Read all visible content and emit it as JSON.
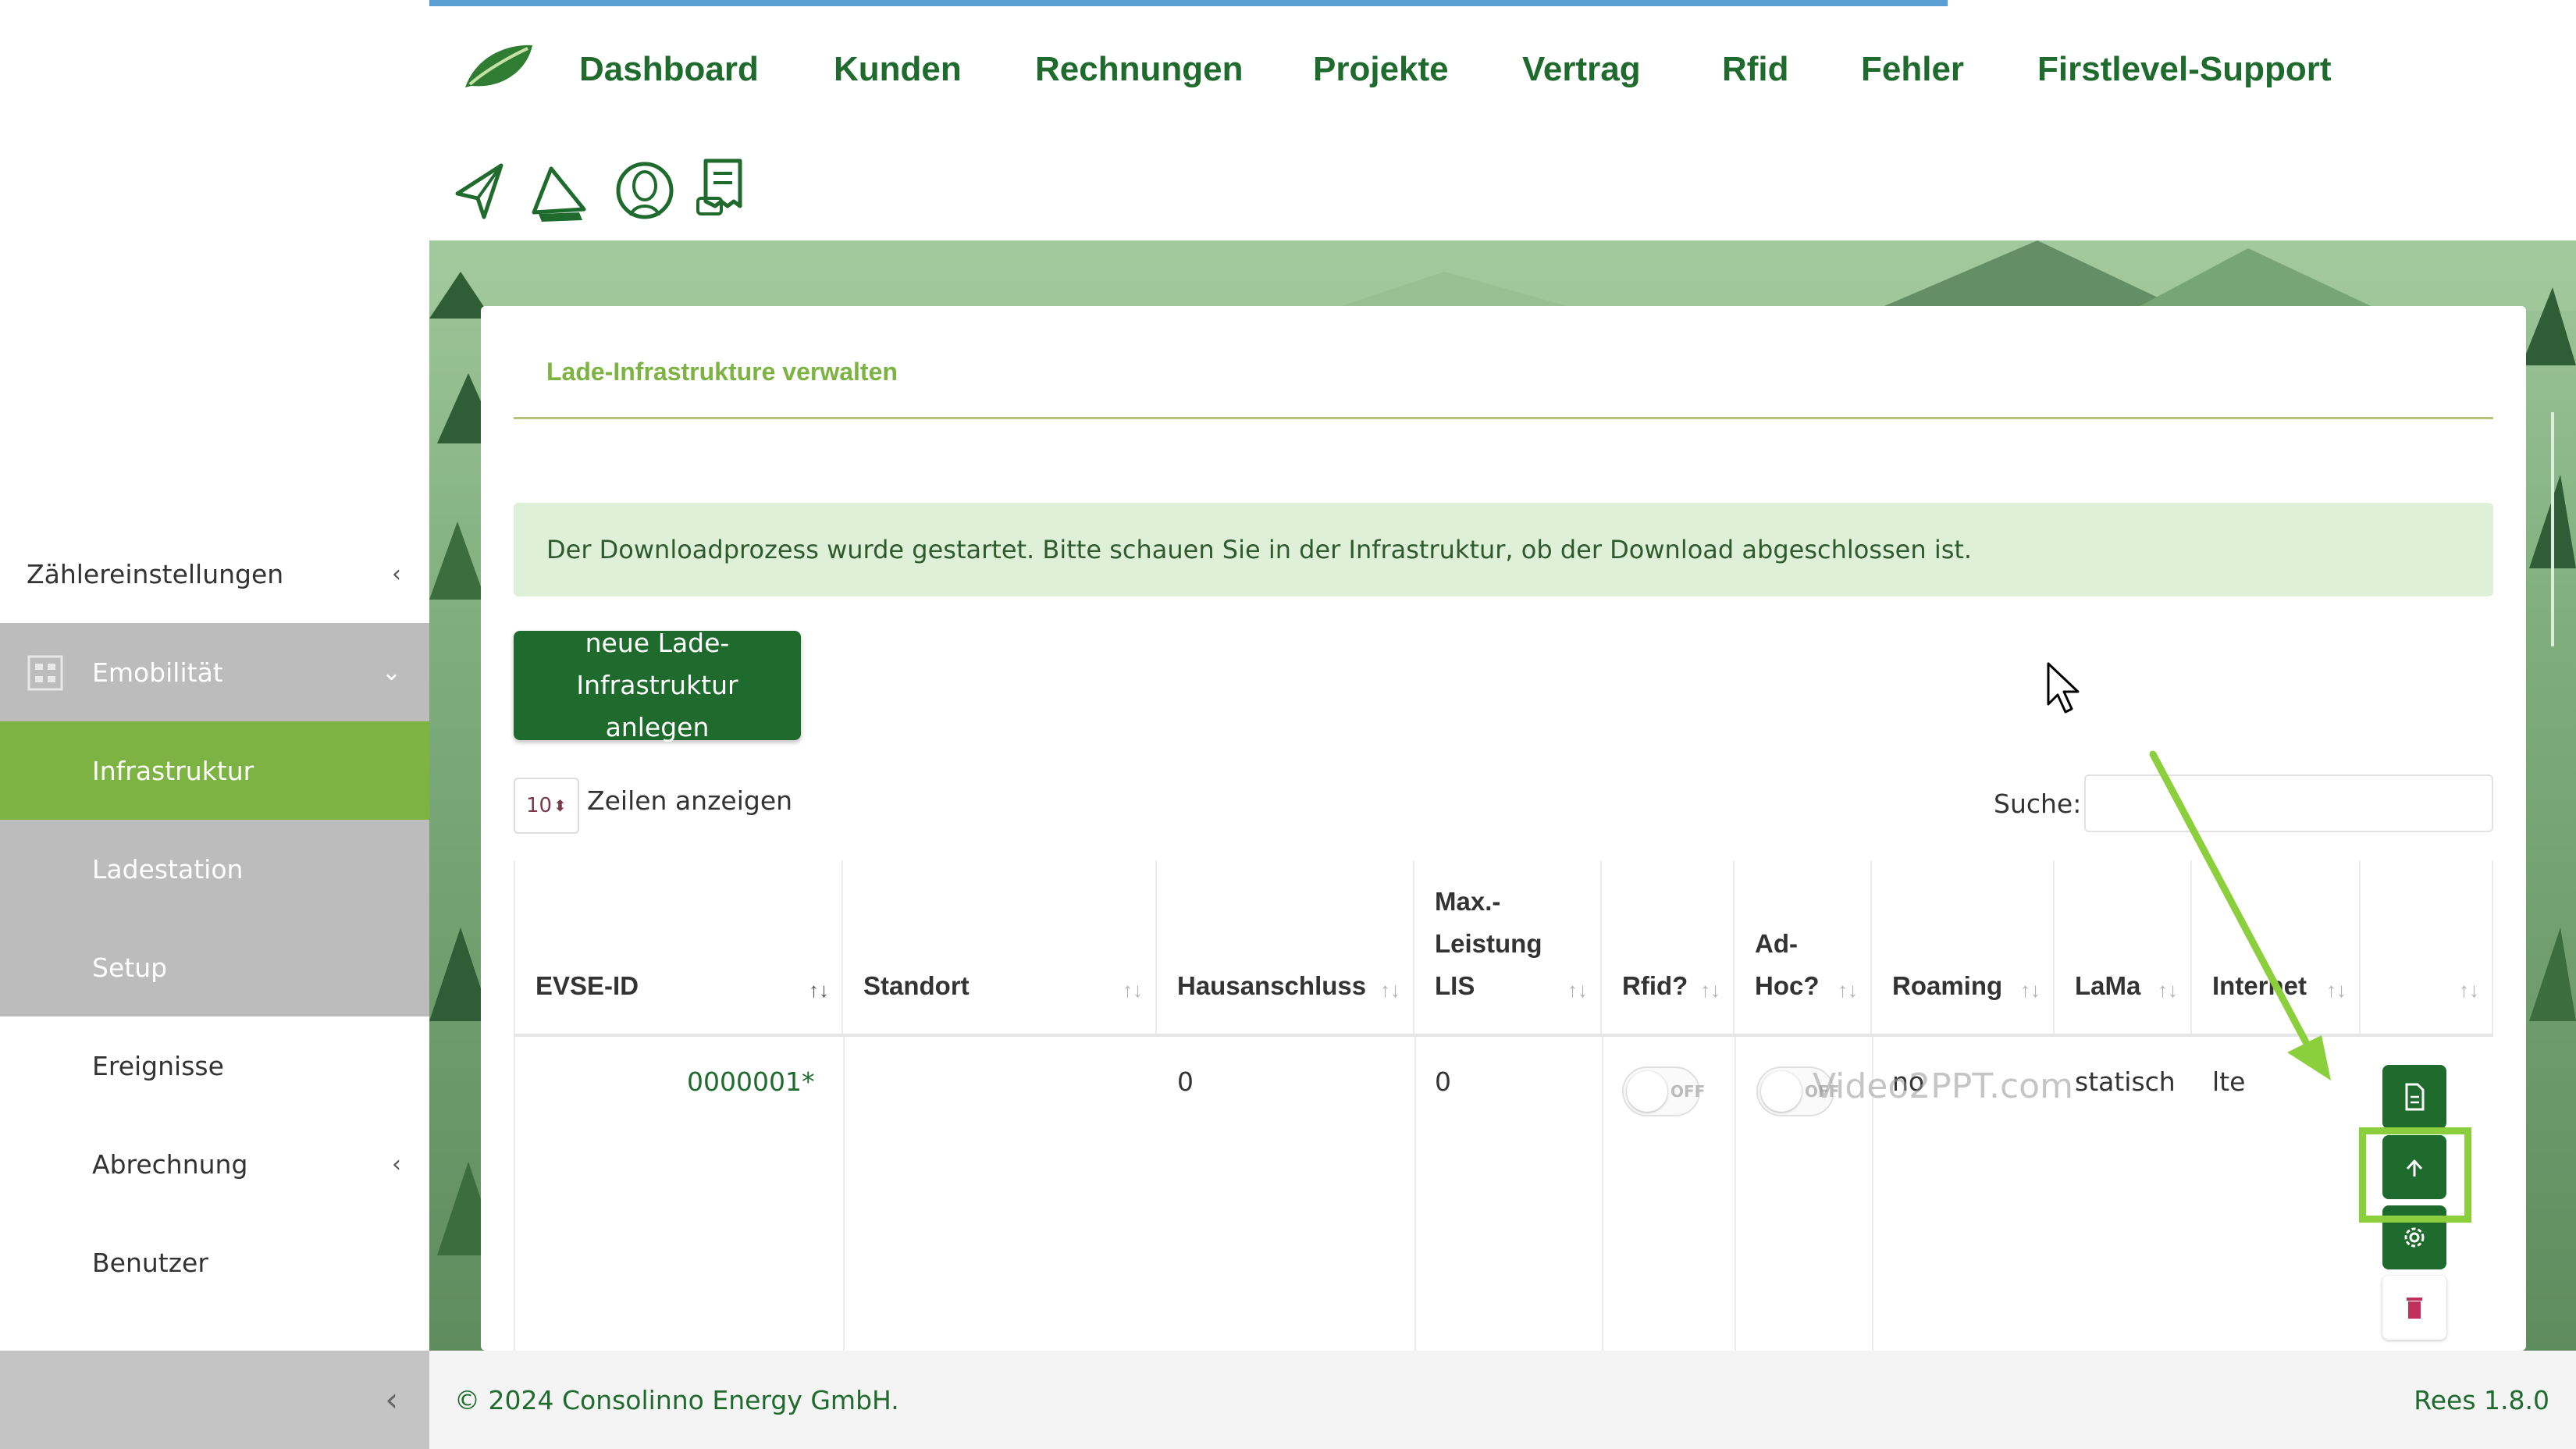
{
  "app": {
    "nav": [
      "Dashboard",
      "Kunden",
      "Rechnungen",
      "Projekte",
      "Vertrag",
      "Rfid",
      "Fehler",
      "Firstlevel-Support"
    ],
    "tool_icons": [
      "send-icon",
      "megaphone-icon",
      "support-agent-icon",
      "receipt-icon"
    ],
    "accent_color": "#1f6b2e",
    "highlight_color": "#7cb342"
  },
  "sidebar": {
    "items": [
      {
        "label": "Zählereinstellungen",
        "chevron": "‹"
      },
      {
        "label": "Emobilität",
        "chevron": "⌄",
        "icon": "grid-icon"
      },
      {
        "label": "Infrastruktur"
      },
      {
        "label": "Ladestation"
      },
      {
        "label": "Setup"
      },
      {
        "label": "Ereignisse"
      },
      {
        "label": "Abrechnung",
        "chevron": "‹"
      },
      {
        "label": "Benutzer"
      }
    ],
    "collapse_chevron": "‹"
  },
  "card": {
    "title": "Lade-Infrastrukture verwalten",
    "alert": "Der Downloadprozess wurde gestartet. Bitte schauen Sie in der Infrastruktur, ob der Download abgeschlossen ist.",
    "new_button": "neue Lade-Infrastruktur anlegen",
    "page_length": "10",
    "page_length_label": "Zeilen anzeigen",
    "search_label": "Suche:",
    "search_value": ""
  },
  "table": {
    "columns": [
      {
        "label": "EVSE-ID"
      },
      {
        "label": "Standort"
      },
      {
        "label": "Hausanschluss"
      },
      {
        "label": "Max.-Leistung LIS"
      },
      {
        "label": "Rfid?"
      },
      {
        "label": "Ad-Hoc?"
      },
      {
        "label": "Roaming"
      },
      {
        "label": "LaMa"
      },
      {
        "label": "Internet"
      },
      {
        "label": ""
      }
    ],
    "rows": [
      {
        "evse_id": "0000001*",
        "standort": "",
        "hausanschluss": "0",
        "max_leistung": "0",
        "rfid": "OFF",
        "adhoc": "OFF",
        "roaming": "no",
        "lama": "statisch",
        "internet": "lte"
      }
    ],
    "row_actions": [
      "document-icon",
      "upload-icon",
      "settings-icon",
      "trash-icon"
    ]
  },
  "footer": {
    "copyright": "© 2024 Consolinno Energy GmbH.",
    "version": "Rees 1.8.0"
  },
  "watermark": "Video2PPT.com"
}
